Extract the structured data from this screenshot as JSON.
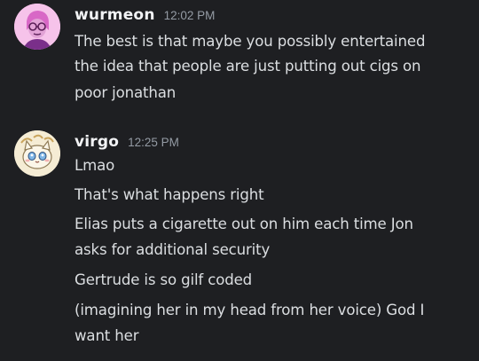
{
  "messages": [
    {
      "username": "wurmeon",
      "timestamp": "12:02 PM",
      "avatar_icon": "pink-cartoon-avatar-icon",
      "lines": [
        "The best is that maybe you possibly entertained",
        "the idea that people are just putting out cigs on",
        "poor jonathan"
      ]
    },
    {
      "username": "virgo",
      "timestamp": "12:25 PM",
      "avatar_icon": "cat-cartoon-avatar-icon",
      "lines": [
        "Lmao",
        "That's what happens right",
        "Elias puts a cigarette out on him each time Jon",
        "asks for additional security",
        "Gertrude is so gilf coded",
        "(imagining her in my head from her voice) God I",
        "want her"
      ]
    }
  ],
  "colors": {
    "background": "#1e1f22",
    "username": "#f2f3f5",
    "timestamp": "#949ba4",
    "message_text": "#dbdee1"
  }
}
